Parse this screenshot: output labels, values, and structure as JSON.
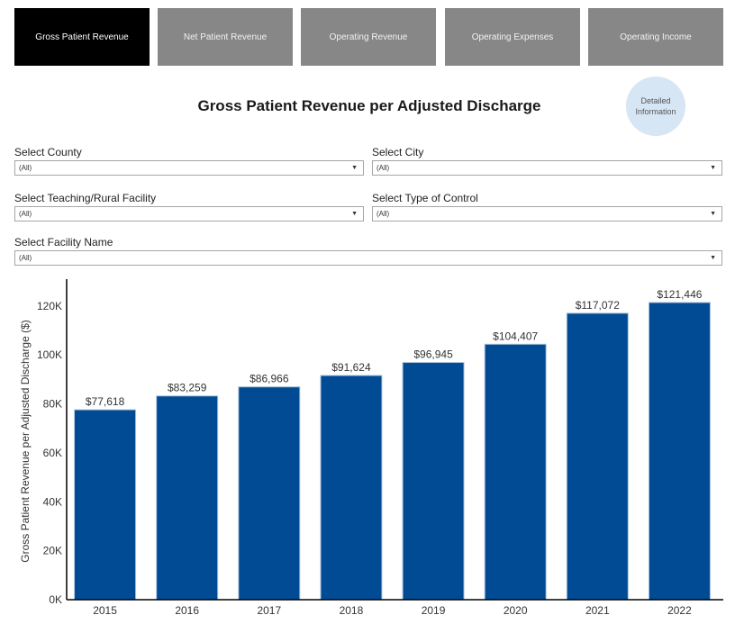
{
  "tabs": [
    {
      "label": "Gross Patient Revenue",
      "active": true
    },
    {
      "label": "Net Patient Revenue",
      "active": false
    },
    {
      "label": "Operating Revenue",
      "active": false
    },
    {
      "label": "Operating Expenses",
      "active": false
    },
    {
      "label": "Operating Income",
      "active": false
    }
  ],
  "info_button": {
    "line1": "Detailed",
    "line2": "Information"
  },
  "filters": {
    "county": {
      "label": "Select County",
      "value": "(All)"
    },
    "city": {
      "label": "Select City",
      "value": "(All)"
    },
    "teaching_rural": {
      "label": "Select Teaching/Rural Facility",
      "value": "(All)"
    },
    "type_of_control": {
      "label": "Select Type of Control",
      "value": "(All)"
    },
    "facility_name": {
      "label": "Select Facility Name",
      "value": "(All)"
    }
  },
  "colors": {
    "bar": "#004b93",
    "active_tab": "#000000",
    "inactive_tab": "#878787",
    "info_button": "#d6e6f4"
  },
  "chart_data": {
    "type": "bar",
    "title": "Gross Patient Revenue per Adjusted Discharge",
    "xlabel": "",
    "ylabel": "Gross Patient Revenue per Adjusted Discharge ($)",
    "categories": [
      "2015",
      "2016",
      "2017",
      "2018",
      "2019",
      "2020",
      "2021",
      "2022"
    ],
    "values": [
      77618,
      83259,
      86966,
      91624,
      96945,
      104407,
      117072,
      121446
    ],
    "data_labels": [
      "$77,618",
      "$83,259",
      "$86,966",
      "$91,624",
      "$96,945",
      "$104,407",
      "$117,072",
      "$121,446"
    ],
    "yticks": [
      0,
      20000,
      40000,
      60000,
      80000,
      100000,
      120000
    ],
    "ytick_labels": [
      "0K",
      "20K",
      "40K",
      "60K",
      "80K",
      "100K",
      "120K"
    ],
    "ylim": [
      0,
      131000
    ],
    "grid": false,
    "legend": "none"
  }
}
